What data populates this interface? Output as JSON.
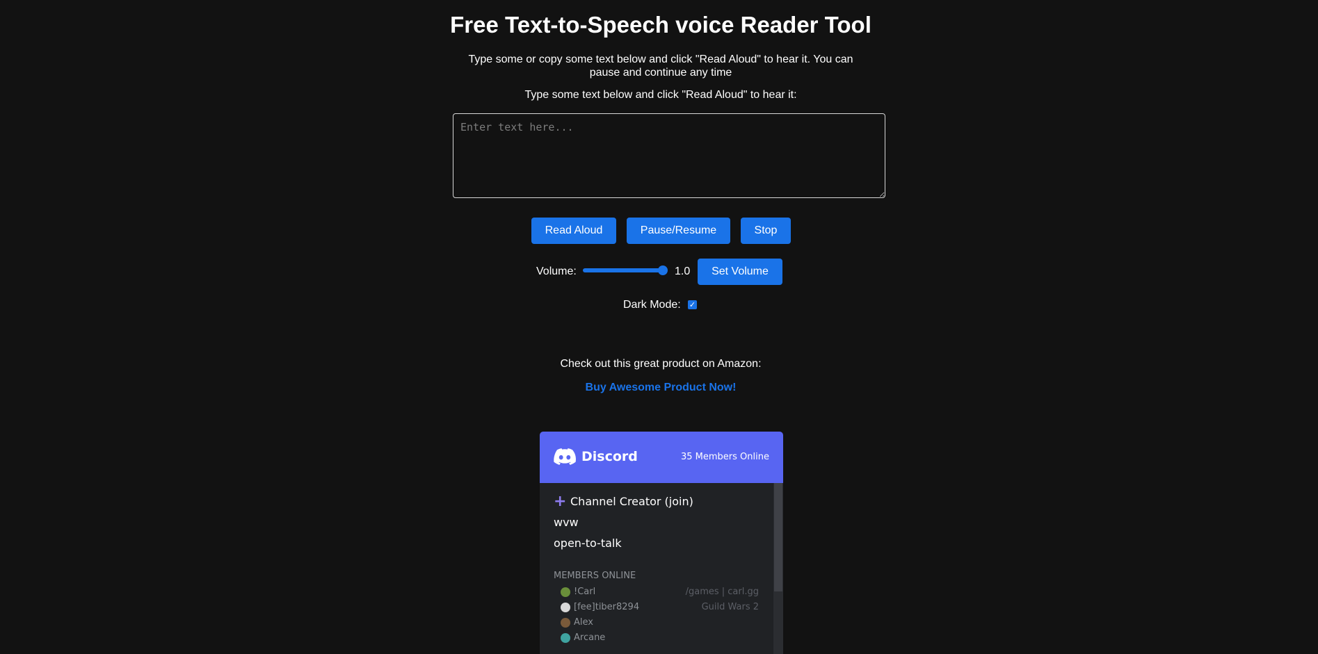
{
  "header": {
    "title": "Free Text-to-Speech voice Reader Tool",
    "intro": "Type some or copy some text below and click \"Read Aloud\" to hear it. You can pause and continue any time",
    "prompt": "Type some text below and click \"Read Aloud\" to hear it:"
  },
  "editor": {
    "placeholder": "Enter text here...",
    "value": ""
  },
  "controls": {
    "read_label": "Read Aloud",
    "pause_label": "Pause/Resume",
    "stop_label": "Stop"
  },
  "volume": {
    "label": "Volume:",
    "value": 1.0,
    "display": "1.0",
    "set_label": "Set Volume"
  },
  "dark_mode": {
    "label": "Dark Mode:",
    "checked": true
  },
  "promo": {
    "text": "Check out this great product on Amazon:",
    "link_label": "Buy Awesome Product Now!"
  },
  "discord": {
    "brand": "Discord",
    "online_count": "35 Members Online",
    "channels": [
      "Channel Creator (join)",
      "wvw",
      "open-to-talk"
    ],
    "members_heading": "MEMBERS ONLINE",
    "members": [
      {
        "name": "!Carl",
        "status": "/games | carl.gg"
      },
      {
        "name": "[fee]tiber8294",
        "status": "Guild Wars 2"
      },
      {
        "name": "Alex",
        "status": ""
      },
      {
        "name": "Arcane",
        "status": ""
      }
    ]
  },
  "colors": {
    "background": "#121212",
    "accent": "#1a73e8",
    "discord_brand": "#5865f2",
    "discord_body": "#202225"
  }
}
